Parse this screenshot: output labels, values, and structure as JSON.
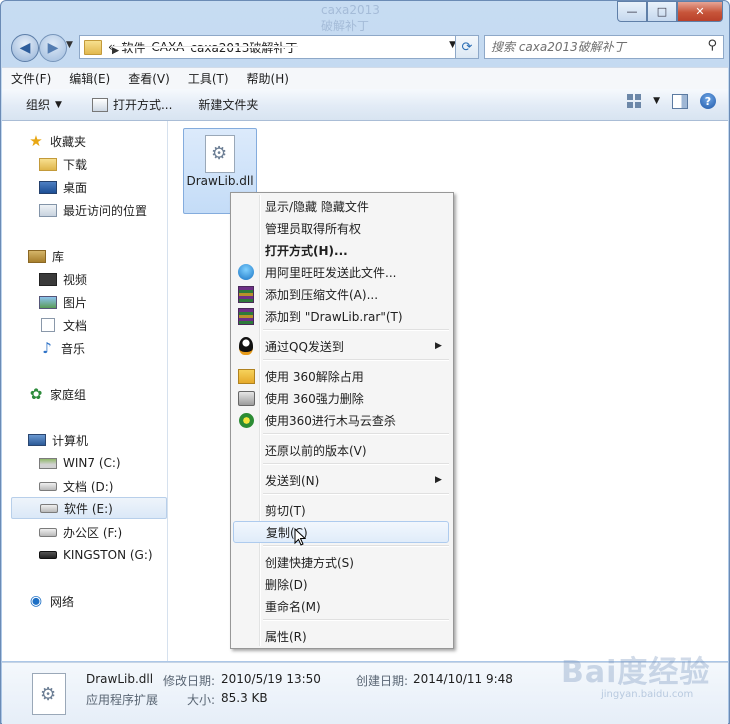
{
  "window": {
    "title": "caxa2013破解补丁",
    "buttons": {
      "minimize": "—",
      "maximize": "□",
      "close": "✕"
    }
  },
  "address": {
    "crumbs": [
      "«",
      "软件",
      "CAXA",
      "caxa2013破解补丁"
    ]
  },
  "search": {
    "placeholder": "搜索 caxa2013破解补丁"
  },
  "menubar": [
    "文件(F)",
    "编辑(E)",
    "查看(V)",
    "工具(T)",
    "帮助(H)"
  ],
  "toolbar": {
    "organize": "组织",
    "open_with": "打开方式...",
    "new_folder": "新建文件夹"
  },
  "nav": {
    "favorites": {
      "label": "收藏夹",
      "items": [
        "下载",
        "桌面",
        "最近访问的位置"
      ]
    },
    "libraries": {
      "label": "库",
      "items": [
        "视频",
        "图片",
        "文档",
        "音乐"
      ]
    },
    "homegroup": "家庭组",
    "computer": {
      "label": "计算机",
      "items": [
        "WIN7 (C:)",
        "文档 (D:)",
        "软件 (E:)",
        "办公区 (F:)",
        "KINGSTON (G:)"
      ]
    },
    "network": "网络"
  },
  "file": {
    "name": "DrawLib.dll"
  },
  "context_menu": {
    "items": [
      "显示/隐藏 隐藏文件",
      "管理员取得所有权",
      "打开方式(H)...",
      "用阿里旺旺发送此文件...",
      "添加到压缩文件(A)...",
      "添加到 \"DrawLib.rar\"(T)",
      "通过QQ发送到",
      "使用 360解除占用",
      "使用 360强力删除",
      "使用360进行木马云查杀",
      "还原以前的版本(V)",
      "发送到(N)",
      "剪切(T)",
      "复制(C)",
      "创建快捷方式(S)",
      "删除(D)",
      "重命名(M)",
      "属性(R)"
    ]
  },
  "details": {
    "name": "DrawLib.dll",
    "type": "应用程序扩展",
    "modified_label": "修改日期:",
    "modified": "2010/5/19 13:50",
    "created_label": "创建日期:",
    "created": "2014/10/11 9:48",
    "size_label": "大小:",
    "size": "85.3 KB"
  },
  "watermark": {
    "brand": "Bai度经验",
    "url": "jingyan.baidu.com"
  }
}
